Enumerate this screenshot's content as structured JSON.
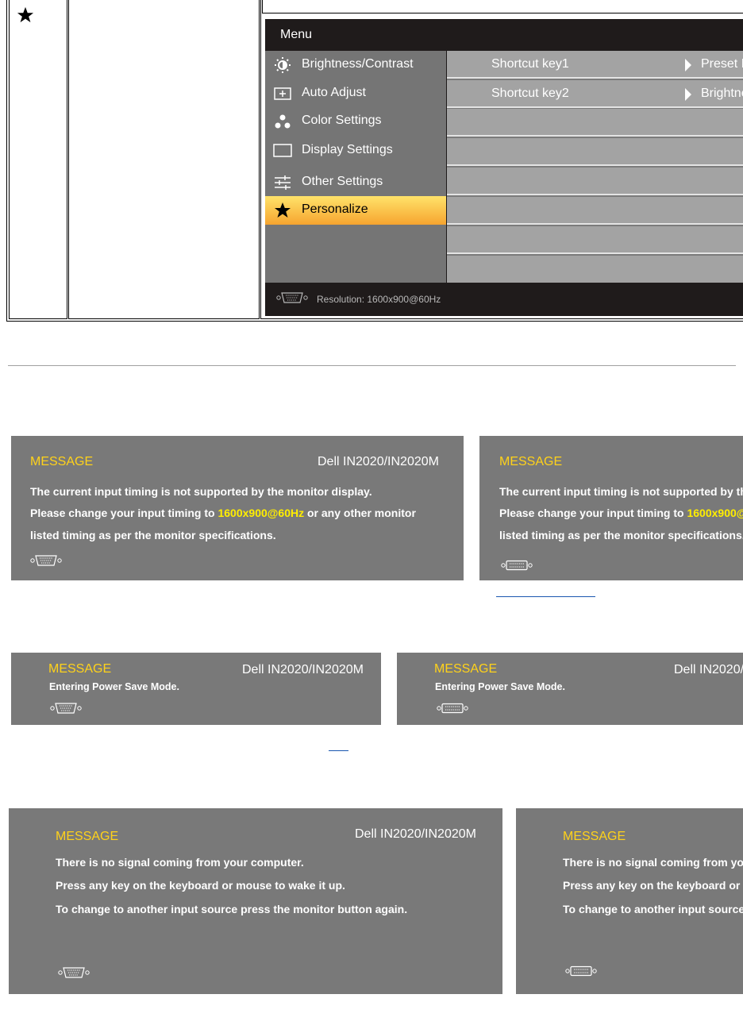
{
  "table": {
    "star_icon": "star-icon"
  },
  "osd": {
    "title": "Menu",
    "items": [
      {
        "label": "Brightness/Contrast",
        "icon": "brightness-icon"
      },
      {
        "label": "Auto Adjust",
        "icon": "auto-adjust-icon"
      },
      {
        "label": "Color Settings",
        "icon": "color-settings-icon"
      },
      {
        "label": "Display Settings",
        "icon": "display-settings-icon"
      },
      {
        "label": "Other Settings",
        "icon": "other-settings-icon"
      },
      {
        "label": "Personalize",
        "icon": "star-icon",
        "active": true
      }
    ],
    "submenu": [
      {
        "key": "Shortcut key1",
        "value": "Preset Modes"
      },
      {
        "key": "Shortcut key2",
        "value": "Brightness/Contrast"
      }
    ],
    "footer": "Resolution: 1600x900@60Hz",
    "colors": {
      "active_top": "#ffe36a",
      "active_bottom": "#f6a42f",
      "bg": "#1f1b1b"
    }
  },
  "messages": {
    "unsupported": {
      "title": "MESSAGE",
      "model": "Dell IN2020/IN2020M",
      "line1": "The current input timing is not supported by the monitor display.",
      "line2_a": "Please change your input timing to ",
      "line2_hl": "1600x900@60Hz",
      "line2_b": " or any other monitor",
      "line3": "listed timing as per the monitor specifications."
    },
    "powersave": {
      "title": "MESSAGE",
      "model": "Dell IN2020/IN2020M",
      "line1": "Entering Power Save Mode."
    },
    "nosignal": {
      "title": "MESSAGE",
      "model": "Dell IN2020/IN2020M",
      "line1": "There is no signal coming from your computer.",
      "line2": "Press any key on the keyboard or mouse to wake it up.",
      "line3": "To change to another input source press the monitor button again."
    }
  }
}
